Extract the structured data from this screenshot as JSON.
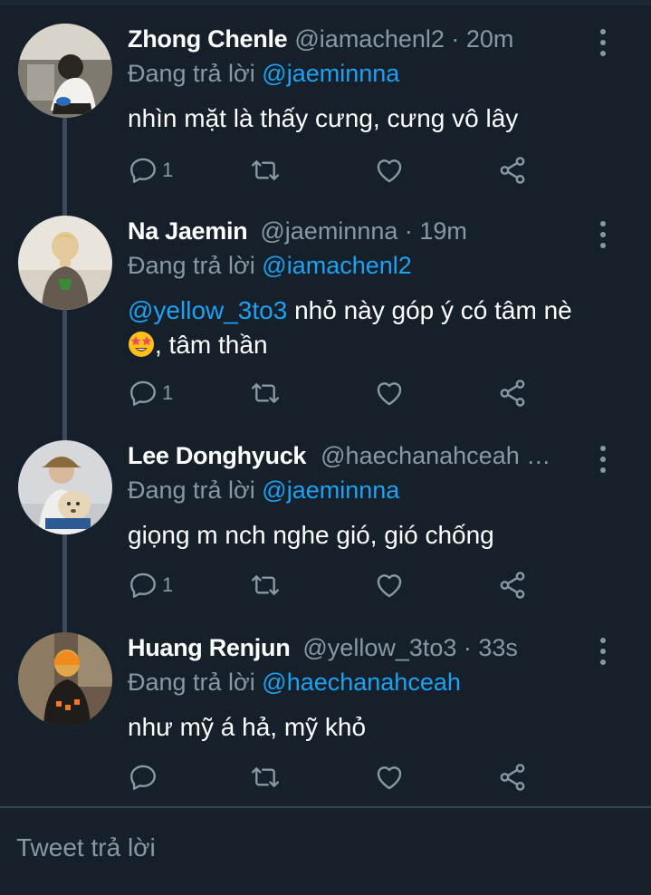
{
  "tweets": [
    {
      "name": "Zhong Chenle",
      "handle": "@iamachenl2 · 20m",
      "replying_prefix": "Đang trả lời",
      "replying_to": "@jaeminnna",
      "text": "nhìn mặt là thấy cưng, cưng vô lây",
      "reply_count": "1"
    },
    {
      "name": "Na Jaemin",
      "handle": "@jaeminnna · 19m",
      "replying_prefix": "Đang trả lời",
      "replying_to": "@iamachenl2",
      "text_mention": "@yellow_3to3",
      "text_part1": " nhỏ này góp ý có tâm nè",
      "text_part2": ", tâm thần",
      "reply_count": "1"
    },
    {
      "name": "Lee Donghyuck",
      "handle": "@haechanahceah …",
      "replying_prefix": "Đang trả lời",
      "replying_to": "@jaeminnna",
      "text": "giọng m nch nghe gió, gió chống",
      "reply_count": "1"
    },
    {
      "name": "Huang Renjun",
      "handle": "@yellow_3to3 · 33s",
      "replying_prefix": "Đang trả lời",
      "replying_to": "@haechanahceah",
      "text": "như mỹ á hả, mỹ khỏ",
      "reply_count": ""
    }
  ],
  "reply_box": {
    "placeholder": "Tweet trả lời"
  },
  "colors": {
    "background": "#15202b",
    "secondary_text": "#8899a6",
    "link": "#1da1f2",
    "divider": "#38444d"
  },
  "icons": [
    "reply-icon",
    "retweet-icon",
    "like-icon",
    "share-icon",
    "more-icon",
    "star-struck-emoji"
  ]
}
